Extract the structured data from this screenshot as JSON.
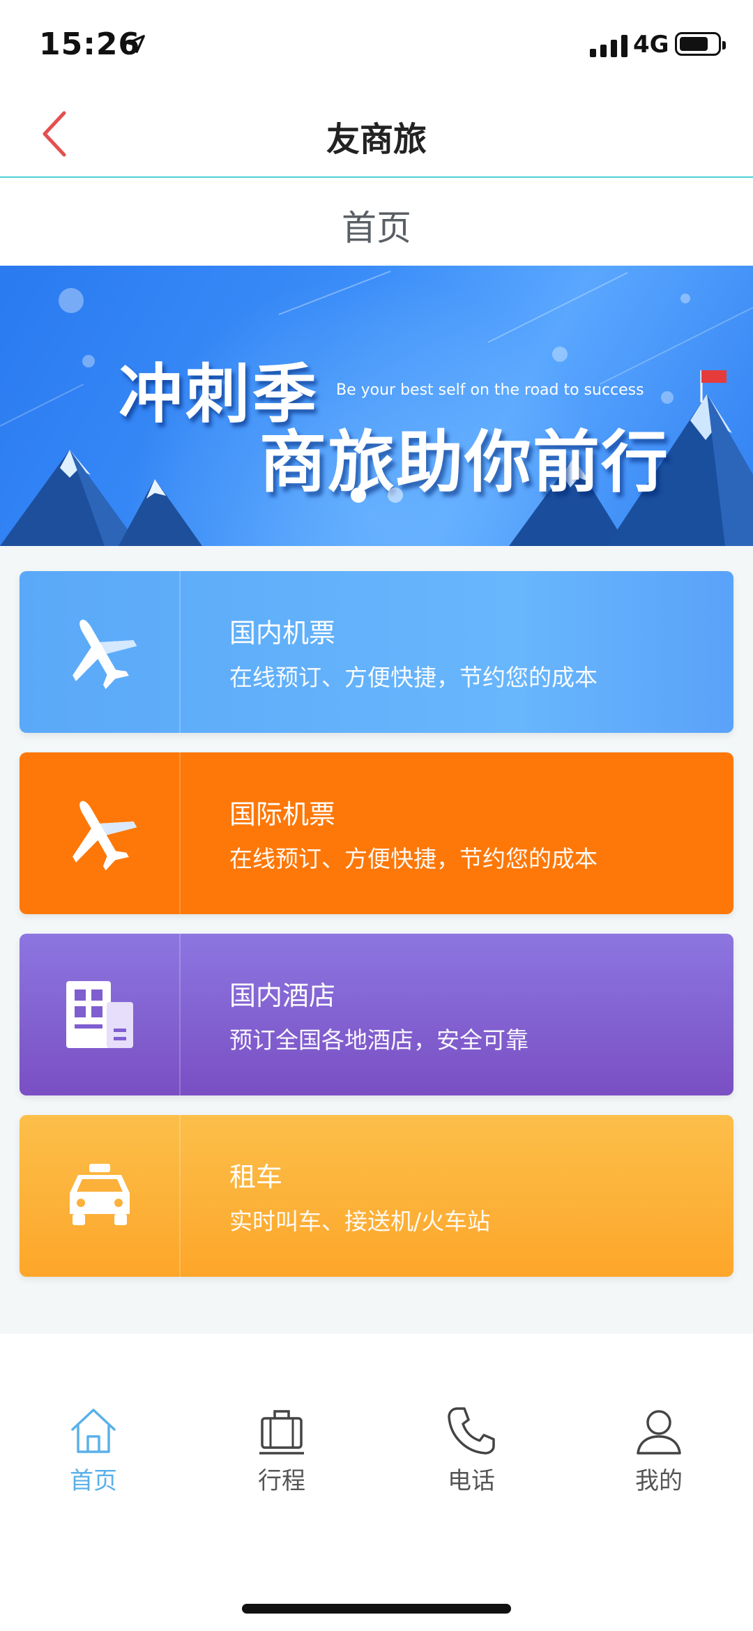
{
  "status_bar": {
    "time": "15:26",
    "network": "4G",
    "icons": [
      "location-arrow-icon",
      "signal-icon",
      "battery-icon"
    ]
  },
  "nav": {
    "title": "友商旅",
    "back_icon": "chevron-left-icon"
  },
  "page": {
    "subtitle": "首页"
  },
  "banner": {
    "headline": "冲刺季",
    "tagline_en": "Be your best self on the road to success",
    "subheadline": "商旅助你前行",
    "slides_total": 2,
    "active_slide": 1
  },
  "services": [
    {
      "title": "国内机票",
      "desc": "在线预订、方便快捷，节约您的成本",
      "icon": "airplane-icon",
      "color": "#5aa9f8"
    },
    {
      "title": "国际机票",
      "desc": "在线预订、方便快捷，节约您的成本",
      "icon": "airplane-icon",
      "color": "#fd7809"
    },
    {
      "title": "国内酒店",
      "desc": "预订全国各地酒店，安全可靠",
      "icon": "hotel-building-icon",
      "color": "#7f5ed0"
    },
    {
      "title": "租车",
      "desc": "实时叫车、接送机/火车站",
      "icon": "taxi-icon",
      "color": "#fdb03a"
    }
  ],
  "tabs": [
    {
      "label": "首页",
      "icon": "home-icon",
      "active": true
    },
    {
      "label": "行程",
      "icon": "suitcase-icon",
      "active": false
    },
    {
      "label": "电话",
      "icon": "phone-icon",
      "active": false
    },
    {
      "label": "我的",
      "icon": "user-icon",
      "active": false
    }
  ],
  "colors": {
    "accent": "#5ab0ea",
    "back_arrow": "#e3504f",
    "nav_divider": "#4ed0d8"
  }
}
